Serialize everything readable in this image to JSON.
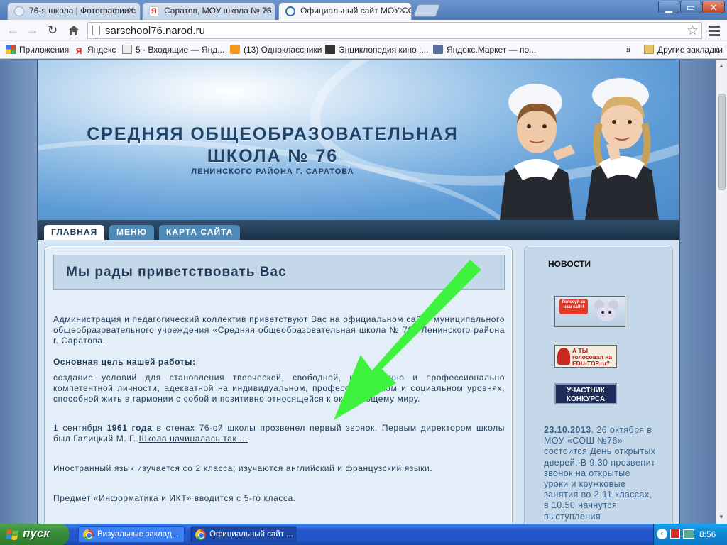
{
  "browser": {
    "tabs": [
      {
        "title": "76-я школа | Фотографии с",
        "icon_color": "#e5edf7"
      },
      {
        "title": "Саратов, МОУ школа № 76",
        "icon_color": "#f03b2c"
      },
      {
        "title": "Официальный сайт МОУ СС",
        "icon_color": "#2f6db5"
      }
    ],
    "url": "sarschool76.narod.ru",
    "window_buttons": {
      "minimize": "▁",
      "maximize": "▭",
      "close": "✕"
    },
    "bookmarks": [
      {
        "label": "Приложения",
        "icon": "apps-grid-icon"
      },
      {
        "label": "Яндекс",
        "icon": "yandex-icon"
      },
      {
        "label": "5 · Входящие — Янд...",
        "icon": "mail-icon"
      },
      {
        "label": "(13) Одноклассники",
        "icon": "odnoklassniki-icon"
      },
      {
        "label": "Энциклопедия кино :...",
        "icon": "film-icon"
      },
      {
        "label": "Яндекс.Маркет — по...",
        "icon": "market-icon"
      }
    ],
    "bookmarks_overflow": "»",
    "other_bookmarks": "Другие закладки"
  },
  "site": {
    "title_line1": "СРЕДНЯЯ ОБЩЕОБРАЗОВАТЕЛЬНАЯ",
    "title_line2": "ШКОЛА № 76",
    "subtitle": "ЛЕНИНСКОГО РАЙОНА Г. САРАТОВА",
    "nav": [
      "ГЛАВНАЯ",
      "МЕНЮ",
      "КАРТА САЙТА"
    ],
    "welcome_heading": "Мы рады приветствовать Вас",
    "intro": "Администрация и педагогический коллектив приветствуют Вас на официальном сайте муниципального общеобразовательного учреждения «Средняя общеобразовательная школа № 76» Ленинского района г. Саратова.",
    "goal_heading": "Основная цель нашей работы:",
    "goal_text": "создание условий для становления творческой, свободной, нравственно и профессионально компетентной личности, адекватной на индивидуальном, профессиональном и социальном уровнях, способной жить в гармонии с собой и позитивно относящейся к окружающему миру.",
    "history_pre": "1 сентября ",
    "history_year": "1961 года",
    "history_post": " в стенах 76-ой школы прозвенел первый звонок. Первым директором школы был Галицкий М. Г. ",
    "history_link": "Школа начиналась так ...",
    "languages": "Иностранный язык изучается со 2 класса; изучаются английский и французский языки.",
    "informatics": "Предмет «Информатика и ИКТ» вводится с 5-го класса.",
    "news_heading": "НОВОСТИ",
    "banners": {
      "vote": "Голосуй за наш сайт!",
      "edutop": "А ТЫ голосовал на EDU-TOP.ru?",
      "contest": "УЧАСТНИК КОНКУРСА"
    },
    "news_date": "23.10.2013",
    "news_text": ". 26 октября в МОУ «СОШ №76» состоится День открытых дверей. В 9.30 прозвенит звонок на открытые уроки и кружковые занятия во 2-11 классах, в 10.50 начнутся выступления"
  },
  "taskbar": {
    "start": "пуск",
    "items": [
      "Визуальные заклад...",
      "Официальный сайт ..."
    ],
    "clock": "8:56"
  },
  "colors": {
    "annotation_arrow": "#3ef33e",
    "site_text": "#1f3a57",
    "news_text": "#35628c"
  }
}
